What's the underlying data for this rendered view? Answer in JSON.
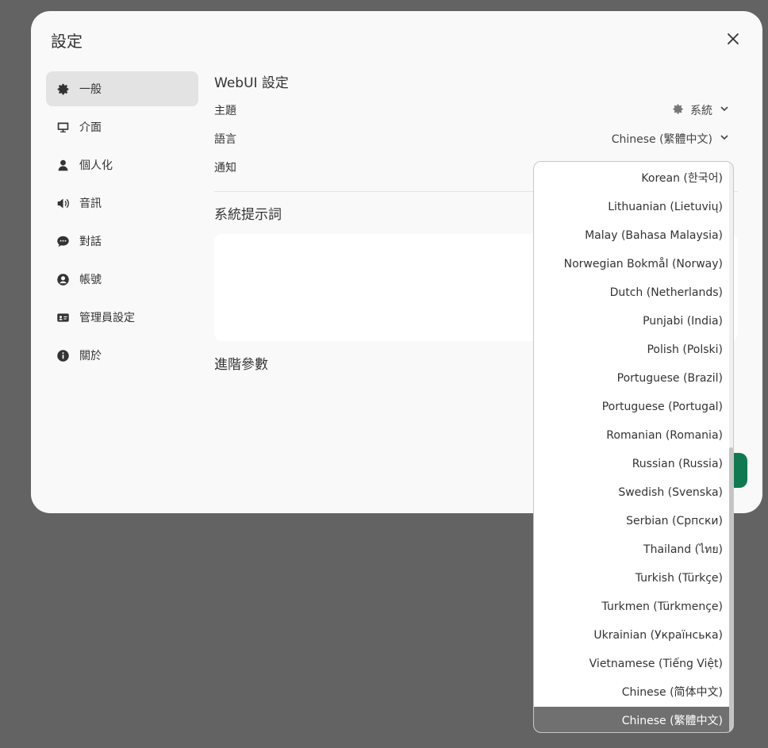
{
  "modal": {
    "title": "設定",
    "close_icon": "close-icon"
  },
  "sidebar": {
    "items": [
      {
        "label": "一般",
        "icon": "gear-icon",
        "active": true
      },
      {
        "label": "介面",
        "icon": "monitor-icon"
      },
      {
        "label": "個人化",
        "icon": "user-icon"
      },
      {
        "label": "音訊",
        "icon": "speaker-icon"
      },
      {
        "label": "對話",
        "icon": "chat-bubble-icon"
      },
      {
        "label": "帳號",
        "icon": "user-circle-icon"
      },
      {
        "label": "管理員設定",
        "icon": "id-card-icon"
      },
      {
        "label": "關於",
        "icon": "info-icon"
      }
    ]
  },
  "general": {
    "section_title": "WebUI 設定",
    "theme_label": "主題",
    "theme_value": "系統",
    "language_label": "語言",
    "language_value": "Chinese (繁體中文)",
    "notification_label": "通知",
    "system_prompt_title": "系統提示詞",
    "advanced_title": "進階參數"
  },
  "language_dropdown": {
    "options": [
      "Korean (한국어)",
      "Lithuanian (Lietuvių)",
      "Malay (Bahasa Malaysia)",
      "Norwegian Bokmål (Norway)",
      "Dutch (Netherlands)",
      "Punjabi (India)",
      "Polish (Polski)",
      "Portuguese (Brazil)",
      "Portuguese (Portugal)",
      "Romanian (Romania)",
      "Russian (Russia)",
      "Swedish (Svenska)",
      "Serbian (Српски)",
      "Thailand (ไทย)",
      "Turkish (Türkçe)",
      "Turkmen (Türkmençe)",
      "Ukrainian (Українська)",
      "Vietnamese (Tiếng Việt)",
      "Chinese (简体中文)",
      "Chinese (繁體中文)"
    ],
    "selected": "Chinese (繁體中文)"
  },
  "colors": {
    "accent": "#0f7a4f",
    "selected_bg": "#707070",
    "overlay": "#636363"
  }
}
